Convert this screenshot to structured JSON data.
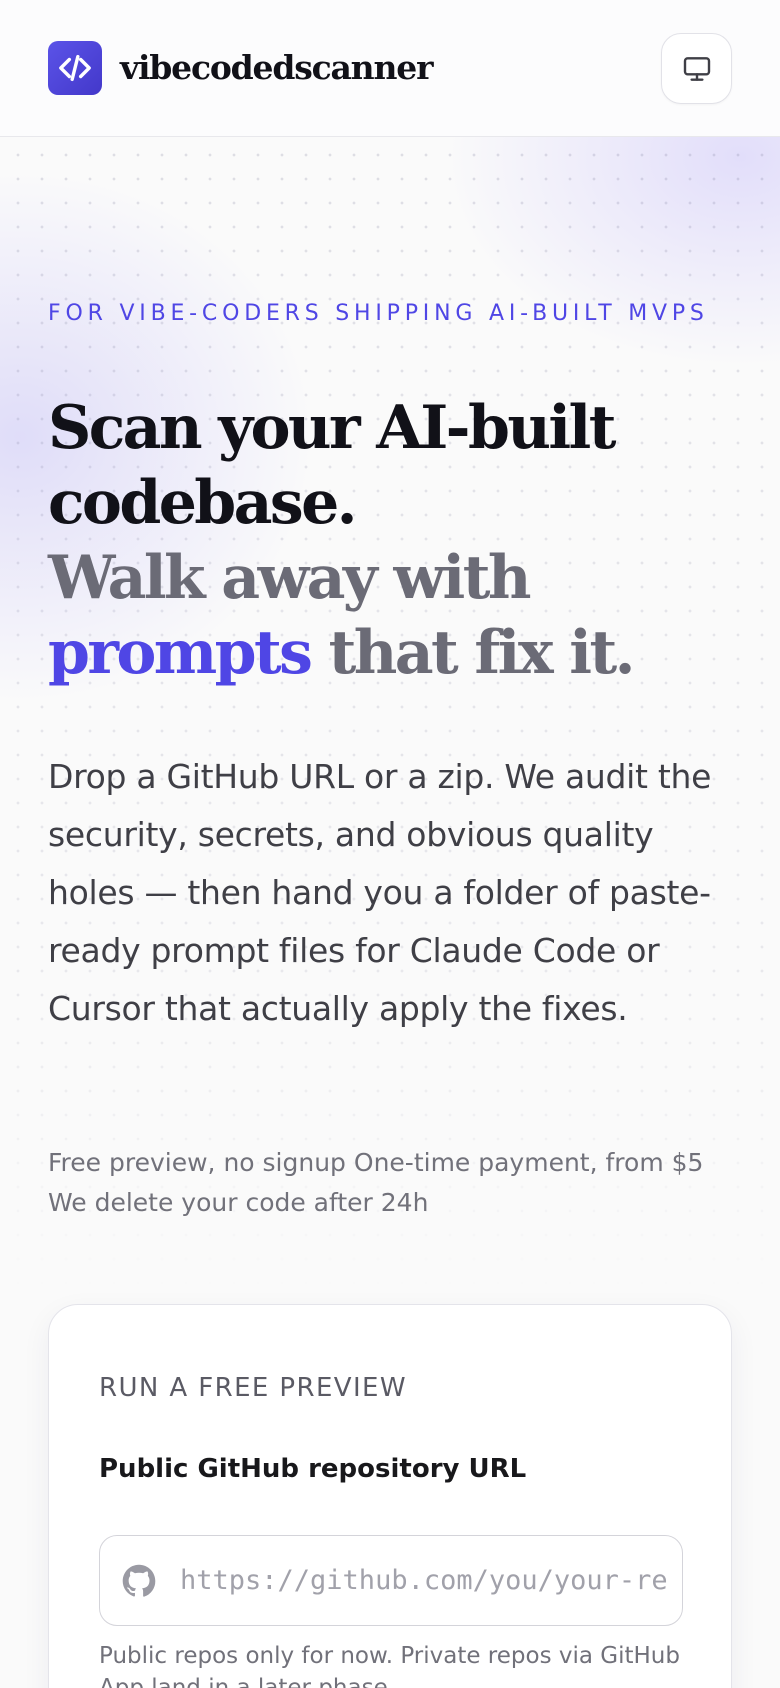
{
  "header": {
    "brand": "vibecodedscanner",
    "logo_icon": "code-brackets-icon",
    "theme_icon": "monitor-icon"
  },
  "hero": {
    "eyebrow": "FOR VIBE-CODERS SHIPPING AI-BUILT MVPS",
    "headline_line1": "Scan your AI-built codebase.",
    "headline_line2_prefix": "Walk away with ",
    "headline_accent": "prompts",
    "headline_line2_suffix": " that fix it.",
    "lead": "Drop a GitHub URL or a zip. We audit the security, secrets, and obvious quality holes — then hand you a folder of paste-ready prompt files for Claude Code or Cursor that actually apply the fixes.",
    "meta_1": "Free preview, no signup",
    "meta_2": "One-time payment, from $5",
    "meta_3": "We delete your code after 24h"
  },
  "preview_card": {
    "title": "RUN A FREE PREVIEW",
    "field_label": "Public GitHub repository URL",
    "input_placeholder": "https://github.com/you/your-repo",
    "input_value": "",
    "input_icon": "github-icon",
    "hint": "Public repos only for now. Private repos via GitHub App land in a later phase."
  },
  "colors": {
    "accent": "#4f46e5",
    "muted_text": "#6b6b76",
    "background": "#fafafa"
  }
}
